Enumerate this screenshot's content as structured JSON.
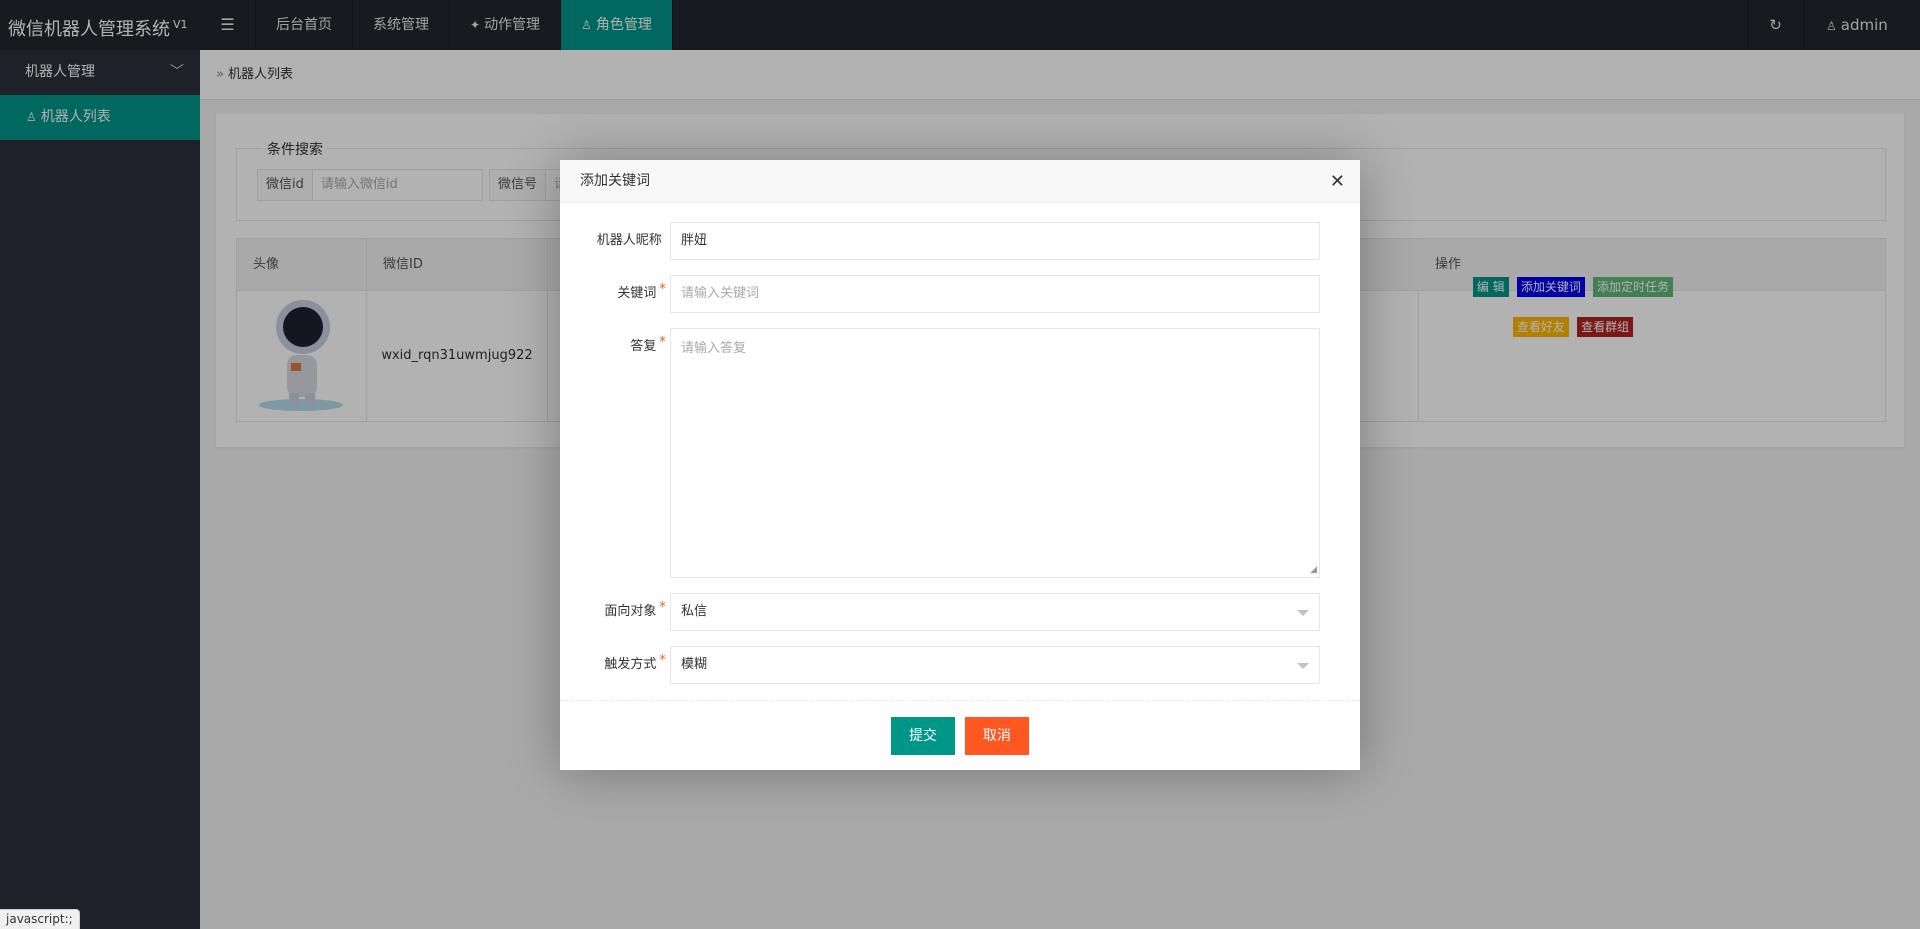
{
  "app": {
    "title": "微信机器人管理系统",
    "version": "V1"
  },
  "top_nav": {
    "items": [
      {
        "label": "后台首页"
      },
      {
        "label": "系统管理"
      },
      {
        "label": "动作管理"
      },
      {
        "label": "角色管理",
        "active": true
      }
    ]
  },
  "user": {
    "name": "admin"
  },
  "sidebar": {
    "group": {
      "label": "机器人管理"
    },
    "items": [
      {
        "label": "机器人列表",
        "active": true
      }
    ]
  },
  "breadcrumb": {
    "current": "机器人列表"
  },
  "search": {
    "legend": "条件搜索",
    "fields": [
      {
        "label": "微信id",
        "placeholder": "请输入微信id"
      },
      {
        "label": "微信号",
        "placeholder": "请"
      }
    ]
  },
  "table": {
    "headers": [
      "头像",
      "微信ID",
      "操作"
    ],
    "rows": [
      {
        "wxid": "wxid_rqn31uwmjug922"
      }
    ],
    "actions": [
      {
        "label": "编 辑",
        "color": "#009688"
      },
      {
        "label": "添加关键词",
        "color": "#0000ee"
      },
      {
        "label": "添加定时任务",
        "color": "#5fb878"
      },
      {
        "label": "查看好友",
        "color": "#ffb800"
      },
      {
        "label": "查看群组",
        "color": "#b22222"
      }
    ]
  },
  "modal": {
    "title": "添加关键词",
    "fields": {
      "nickname": {
        "label": "机器人昵称",
        "value": "胖妞"
      },
      "keyword": {
        "label": "关键词",
        "placeholder": "请输入关键词"
      },
      "reply": {
        "label": "答复",
        "placeholder": "请输入答复"
      },
      "target": {
        "label": "面向对象",
        "value": "私信"
      },
      "trigger": {
        "label": "触发方式",
        "value": "模糊"
      }
    },
    "submit": "提交",
    "cancel": "取消"
  },
  "colors": {
    "primary": "#009688",
    "danger": "#ff5722",
    "header_bg": "#23262e",
    "sidebar_bg": "#2d303a"
  },
  "status_bar": "javascript:;"
}
